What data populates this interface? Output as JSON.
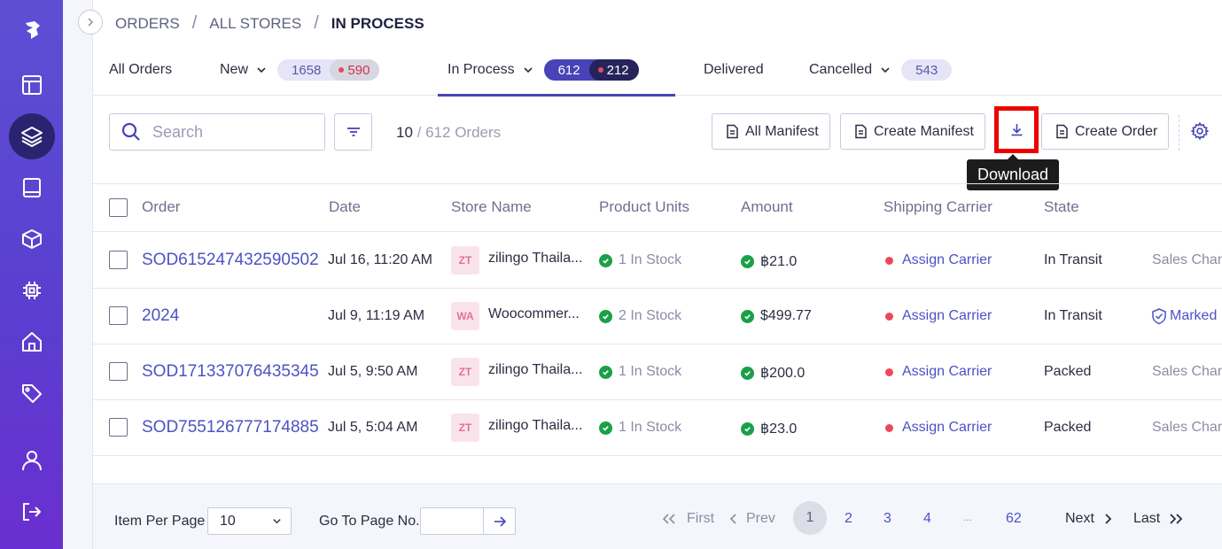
{
  "breadcrumb": [
    "ORDERS",
    "ALL STORES",
    "IN PROCESS"
  ],
  "tabs": {
    "all_orders": "All Orders",
    "new": {
      "label": "New",
      "count": "1658",
      "new_count": "590"
    },
    "in_process": {
      "label": "In Process",
      "count": "612",
      "new_count": "212"
    },
    "delivered": "Delivered",
    "cancelled": {
      "label": "Cancelled",
      "count": "543"
    }
  },
  "toolbar": {
    "search_placeholder": "Search",
    "shown": "10",
    "total": "/ 612 Orders",
    "all_manifest": "All Manifest",
    "create_manifest": "Create Manifest",
    "create_order": "Create Order",
    "download_tooltip": "Download"
  },
  "table": {
    "columns": [
      "Order",
      "Date",
      "Store Name",
      "Product Units",
      "Amount",
      "Shipping Carrier",
      "State"
    ],
    "rows": [
      {
        "order": "SOD615247432590502",
        "date": "Jul 16, 11:20 AM",
        "store_badge": "ZT",
        "store": "zilingo Thaila...",
        "units": "1 In Stock",
        "amount": "฿21.0",
        "carrier": "Assign Carrier",
        "state": "In Transit",
        "channel": "Sales Chan"
      },
      {
        "order": "2024",
        "date": "Jul 9, 11:19 AM",
        "store_badge": "WA",
        "store": "Woocommer...",
        "units": "2 In Stock",
        "amount": "$499.77",
        "carrier": "Assign Carrier",
        "state": "In Transit",
        "channel": "Marked"
      },
      {
        "order": "SOD171337076435345",
        "date": "Jul 5, 9:50 AM",
        "store_badge": "ZT",
        "store": "zilingo Thaila...",
        "units": "1 In Stock",
        "amount": "฿200.0",
        "carrier": "Assign Carrier",
        "state": "Packed",
        "channel": "Sales Chan"
      },
      {
        "order": "SOD755126777174885",
        "date": "Jul 5, 5:04 AM",
        "store_badge": "ZT",
        "store": "zilingo Thaila...",
        "units": "1 In Stock",
        "amount": "฿23.0",
        "carrier": "Assign Carrier",
        "state": "Packed",
        "channel": "Sales Chan"
      }
    ]
  },
  "footer": {
    "item_per_page_label": "Item Per Page",
    "item_per_page_value": "10",
    "goto_label": "Go To Page No.",
    "first": "First",
    "prev": "Prev",
    "pages": [
      "1",
      "2",
      "3",
      "4",
      "...",
      "62"
    ],
    "next": "Next",
    "last": "Last"
  },
  "colors": {
    "accent": "#4644b6",
    "highlight": "#ee0000",
    "sidebar": "#5a3fd0"
  }
}
